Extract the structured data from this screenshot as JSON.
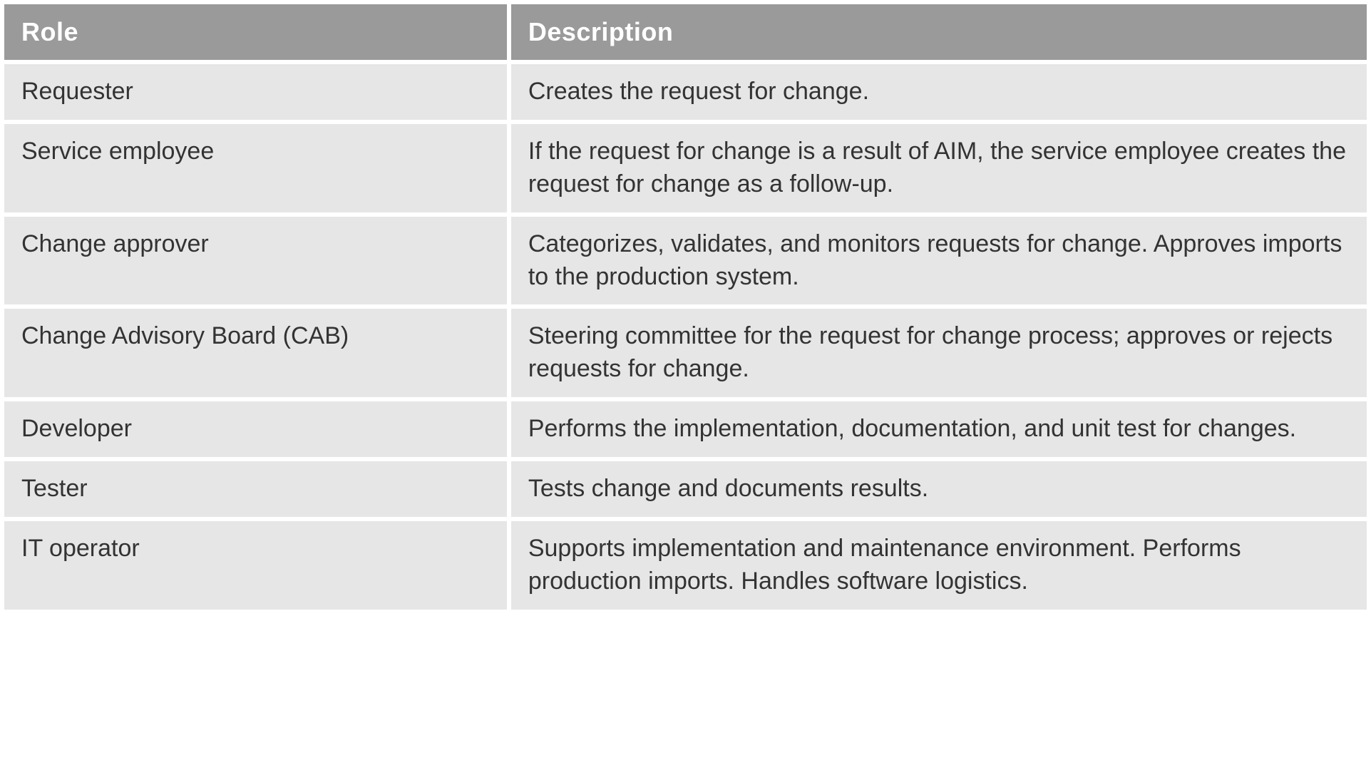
{
  "table": {
    "headers": {
      "role": "Role",
      "description": "Description"
    },
    "rows": [
      {
        "role": "Requester",
        "description": "Creates the request for change."
      },
      {
        "role": "Service employee",
        "description": "If the request for change is a result of AIM, the service employee creates the request for change as a follow-up."
      },
      {
        "role": "Change approver",
        "description": "Categorizes, validates, and monitors requests for change. Approves imports to the production system."
      },
      {
        "role": "Change Advisory Board (CAB)",
        "description": "Steering committee for the request for change process; approves or rejects requests for change."
      },
      {
        "role": "Developer",
        "description": "Performs the implementation, documentation, and unit test for changes."
      },
      {
        "role": "Tester",
        "description": "Tests change and documents results."
      },
      {
        "role": "IT operator",
        "description": "Supports implementation and maintenance environ­ment. Performs production imports. Handles soft­ware logistics."
      }
    ]
  }
}
